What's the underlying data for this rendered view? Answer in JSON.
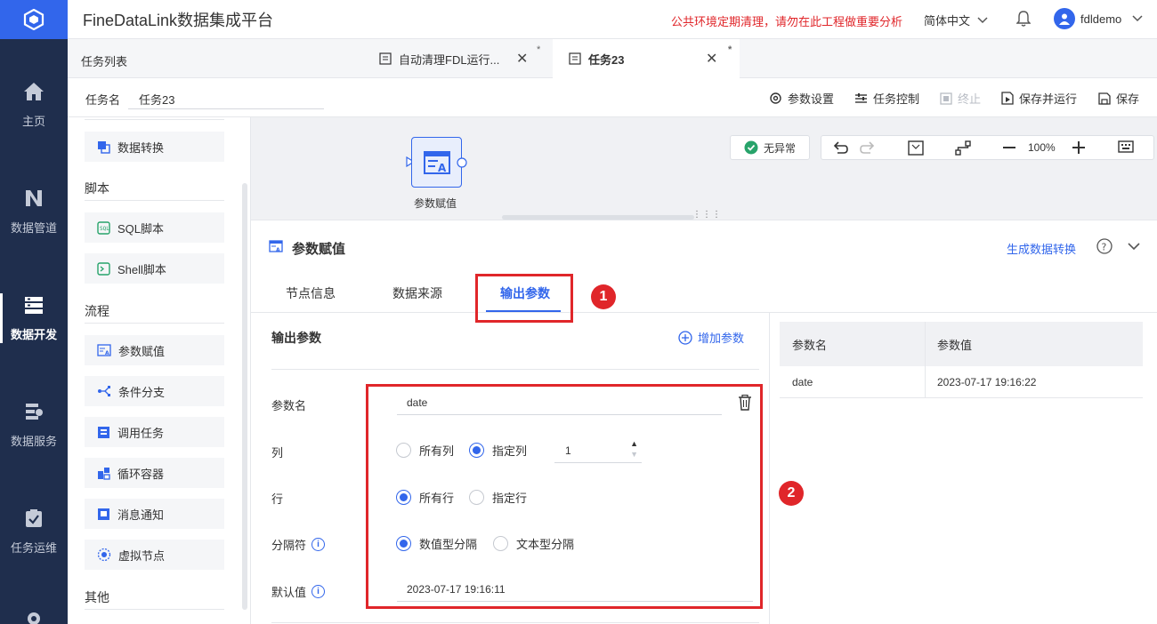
{
  "app": {
    "title": "FineDataLink数据集成平台",
    "notice": "公共环境定期清理，请勿在此工程做重要分析",
    "language": "简体中文",
    "username": "fdldemo"
  },
  "nav": {
    "items": [
      {
        "label": "主页",
        "icon": "home-icon"
      },
      {
        "label": "数据管道",
        "icon": "pipeline-icon"
      },
      {
        "label": "数据开发",
        "icon": "develop-icon"
      },
      {
        "label": "数据服务",
        "icon": "service-icon"
      },
      {
        "label": "任务运维",
        "icon": "ops-icon"
      }
    ]
  },
  "tabs": {
    "task_list": "任务列表",
    "items": [
      {
        "label": "自动清理FDL运行...",
        "modified": "*"
      },
      {
        "label": "任务23",
        "modified": "*"
      }
    ]
  },
  "task": {
    "name_label": "任务名",
    "name_value": "任务23"
  },
  "toolbar": {
    "param_settings": "参数设置",
    "task_control": "任务控制",
    "stop": "终止",
    "save_run": "保存并运行",
    "save": "保存"
  },
  "palette": {
    "data_transform": "数据转换",
    "script_group": "脚本",
    "sql_script": "SQL脚本",
    "shell_script": "Shell脚本",
    "flow_group": "流程",
    "param_assign": "参数赋值",
    "condition_branch": "条件分支",
    "invoke_task": "调用任务",
    "loop_container": "循环容器",
    "message_notify": "消息通知",
    "virtual_node": "虚拟节点",
    "other_group": "其他"
  },
  "canvas": {
    "node_label": "参数赋值",
    "status": "无异常",
    "zoom": "100%"
  },
  "panel": {
    "title": "参数赋值",
    "generate_link": "生成数据转换",
    "tabs": [
      "节点信息",
      "数据来源",
      "输出参数"
    ],
    "marker1": "1",
    "marker2": "2",
    "section_title": "输出参数",
    "add_param": "增加参数",
    "form": {
      "param_name_label": "参数名",
      "param_name_value": "date",
      "column_label": "列",
      "column_all": "所有列",
      "column_specified": "指定列",
      "column_value": "1",
      "row_label": "行",
      "row_all": "所有行",
      "row_specified": "指定行",
      "separator_label": "分隔符",
      "sep_numeric": "数值型分隔",
      "sep_text": "文本型分隔",
      "default_label": "默认值",
      "default_value": "2023-07-17 19:16:11"
    },
    "table": {
      "headers": [
        "参数名",
        "参数值"
      ],
      "rows": [
        [
          "date",
          "2023-07-17 19:16:22"
        ]
      ]
    }
  },
  "colors": {
    "accent": "#3266eb",
    "nav_bg": "#1f2e4d",
    "alert": "#e0262a"
  }
}
